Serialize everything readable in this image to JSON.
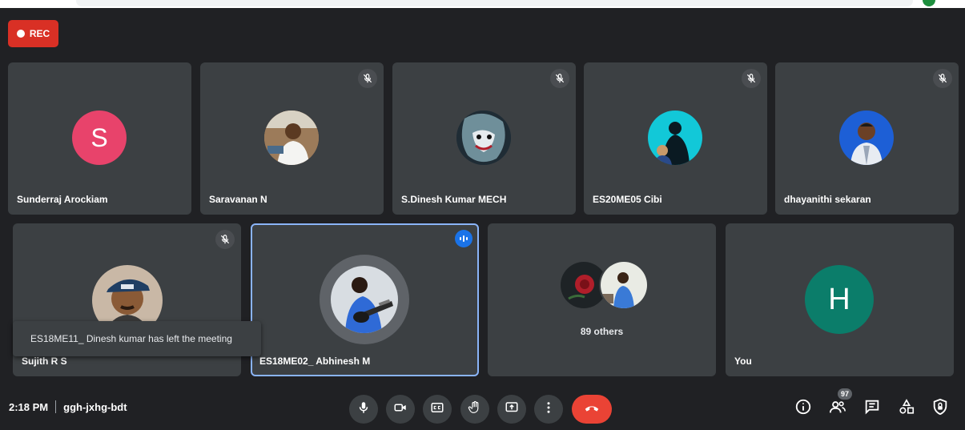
{
  "recording": {
    "label": "REC"
  },
  "participants": [
    {
      "name": "Sunderraj Arockiam",
      "initial": "S",
      "avatar_color": "#e8436b",
      "muted": false
    },
    {
      "name": "Saravanan N",
      "muted": true
    },
    {
      "name": "S.Dinesh Kumar MECH",
      "muted": true
    },
    {
      "name": "ES20ME05 Cibi",
      "muted": true
    },
    {
      "name": "dhayanithi sekaran",
      "muted": true
    },
    {
      "name": "Sujith R S",
      "muted": true
    },
    {
      "name": "ES18ME02_ Abhinesh M",
      "speaking": true
    },
    {
      "label": "89 others"
    },
    {
      "name": "You",
      "initial": "H",
      "avatar_color": "#0b7d6a"
    }
  ],
  "notification": {
    "text": "ES18ME11_ Dinesh kumar has left the meeting"
  },
  "meeting": {
    "time": "2:18 PM",
    "code": "ggh-jxhg-bdt"
  },
  "people_count": "97",
  "icons": {
    "controls": [
      "mic-icon",
      "camera-icon",
      "captions-icon",
      "raise-hand-icon",
      "present-icon",
      "more-icon",
      "end-call-icon"
    ],
    "right": [
      "info-icon",
      "people-icon",
      "chat-icon",
      "activities-icon",
      "host-controls-icon"
    ]
  }
}
